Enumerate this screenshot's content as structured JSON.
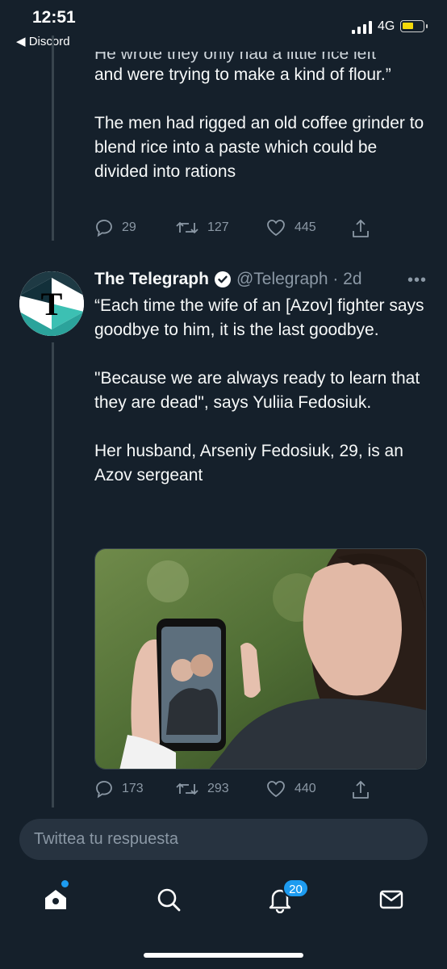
{
  "status_bar": {
    "time": "12:51",
    "back_app": "◀ Discord",
    "network": "4G"
  },
  "previous_tweet": {
    "text_partial": "He wrote they only had a little rice left",
    "text": "and were trying to make a kind of flour.”\n\nThe men had rigged an old coffee grinder to blend rice into a paste which could be divided into rations",
    "replies": "29",
    "retweets": "127",
    "likes": "445"
  },
  "tweet": {
    "author_name": "The Telegraph",
    "handle_time": "@Telegraph · 2d",
    "avatar_letter": "T",
    "text": "“Each time the wife of an [Azov] fighter says goodbye to him, it is the last goodbye.\n\n\"Because we are always ready to learn that they are dead\", says Yuliia Fedosiuk.\n\nHer husband, Arseniy Fedosiuk, 29, is an Azov sergeant",
    "replies": "173",
    "retweets": "293",
    "likes": "440"
  },
  "reply_box": {
    "placeholder": "Twittea tu respuesta"
  },
  "tabbar": {
    "notifications_badge": "20"
  },
  "colors": {
    "background": "#15202b",
    "accent": "#1d9bf0",
    "muted": "#8b98a5",
    "avatar_teal": "#2ba39b"
  },
  "icons": [
    "reply-icon",
    "retweet-icon",
    "like-icon",
    "share-icon",
    "verified-icon",
    "more-icon",
    "home-icon",
    "search-icon",
    "notifications-icon",
    "messages-icon"
  ]
}
